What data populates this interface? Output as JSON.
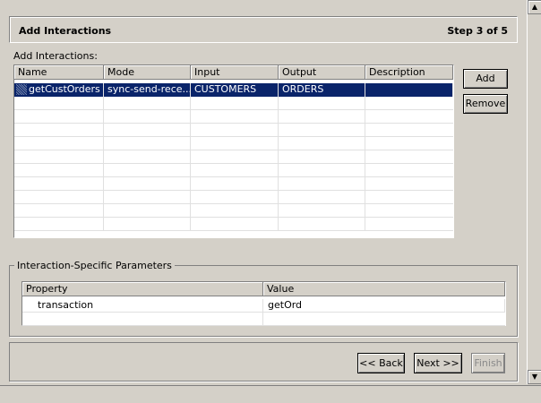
{
  "header": {
    "title": "Add Interactions",
    "step": "Step 3 of 5"
  },
  "interactions": {
    "label": "Add Interactions:",
    "columns": [
      "Name",
      "Mode",
      "Input",
      "Output",
      "Description"
    ],
    "rows": [
      {
        "name": "getCustOrders",
        "mode": "sync-send-rece...",
        "input": "CUSTOMERS",
        "output": "ORDERS",
        "description": ""
      }
    ],
    "add_label": "Add",
    "remove_label": "Remove"
  },
  "params": {
    "label": "Interaction-Specific Parameters",
    "columns": [
      "Property",
      "Value"
    ],
    "rows": [
      {
        "property": "transaction",
        "value": "getOrd"
      }
    ]
  },
  "nav": {
    "back_label": "<< Back",
    "next_label": "Next >>",
    "finish_label": "Finish"
  }
}
